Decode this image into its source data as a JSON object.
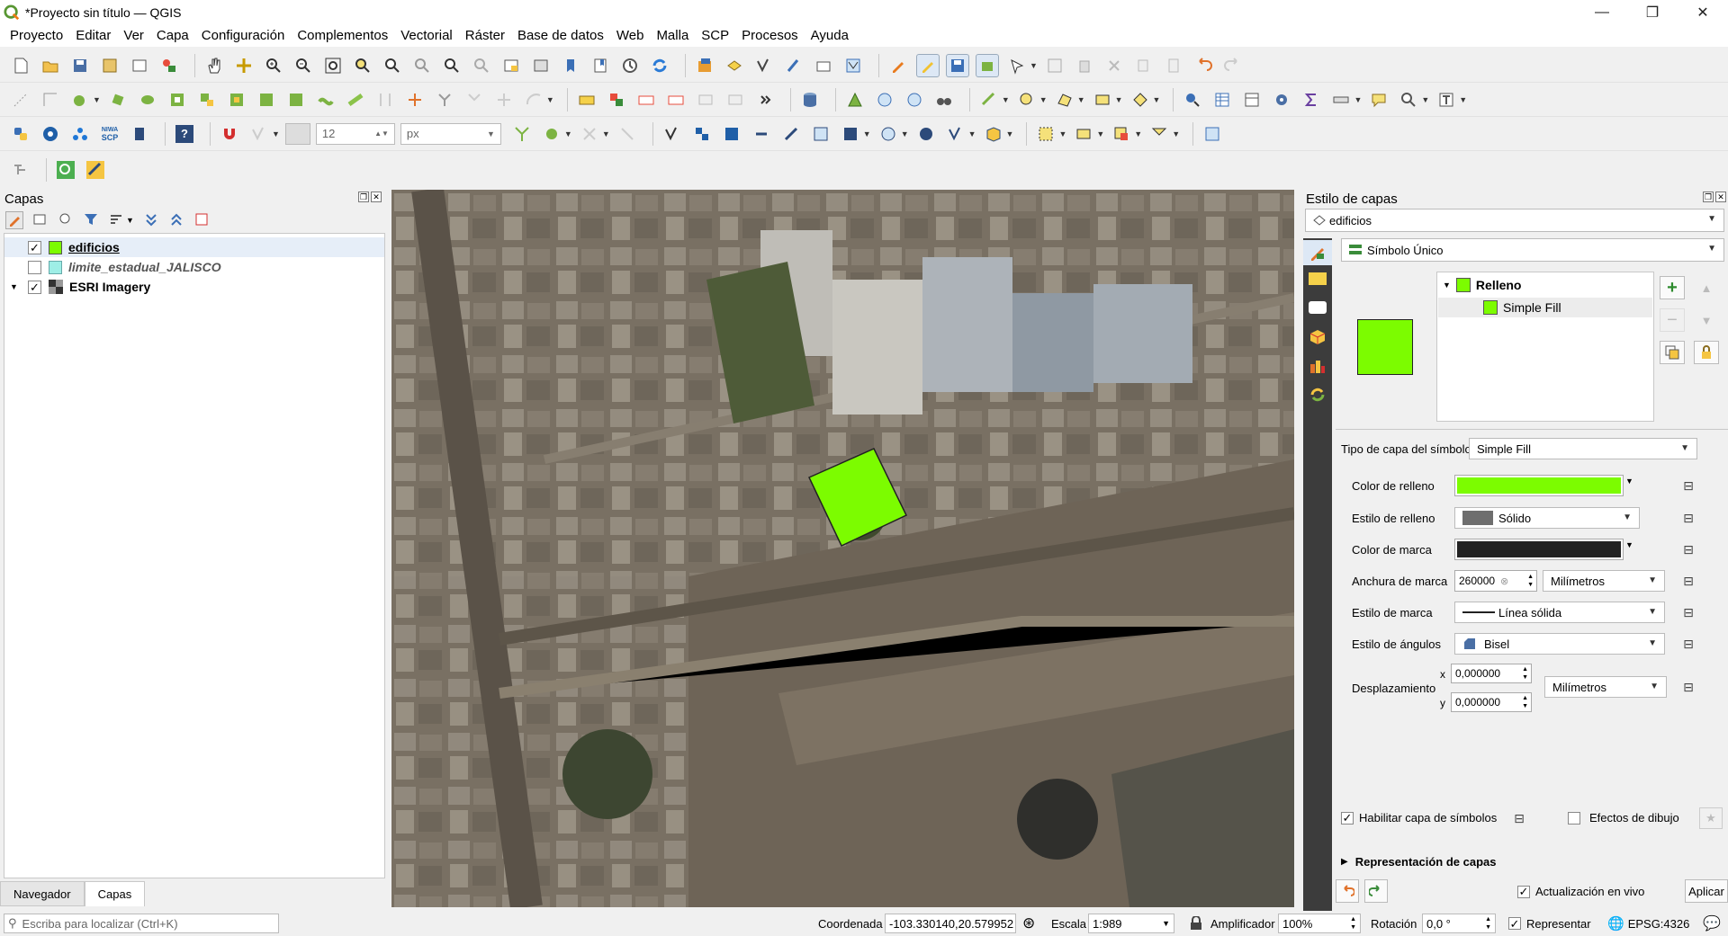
{
  "window": {
    "title": "*Proyecto sin título — QGIS",
    "minimize_glyph": "—",
    "restore_glyph": "❐",
    "close_glyph": "✕"
  },
  "menu": [
    "Proyecto",
    "Editar",
    "Ver",
    "Capa",
    "Configuración",
    "Complementos",
    "Vectorial",
    "Ráster",
    "Base de datos",
    "Web",
    "Malla",
    "SCP",
    "Procesos",
    "Ayuda"
  ],
  "toolbar3": {
    "font_size_value": "12",
    "unit_value": "px",
    "scp_label_top": "NIWA",
    "scp_label_bottom": "SCP",
    "help_glyph": "?"
  },
  "layers_panel": {
    "title": "Capas",
    "layers": [
      {
        "name": "edificios",
        "checked": true,
        "bold": true,
        "italic": false,
        "icon_color": "#7cfc00"
      },
      {
        "name": "limite_estadual_JALISCO",
        "checked": false,
        "bold": true,
        "italic": true,
        "icon_color": "#9eeee6"
      },
      {
        "name": "ESRI Imagery",
        "checked": true,
        "bold": true,
        "italic": false,
        "icon_color": "#333333"
      }
    ],
    "tabs": [
      "Navegador",
      "Capas"
    ]
  },
  "style_panel": {
    "title": "Estilo de capas",
    "layer_select": "edificios",
    "renderer": "Símbolo Único",
    "tree": {
      "root": "Relleno",
      "child": "Simple Fill"
    },
    "symbol_color": "#7cfc00",
    "symbol_layer_type_label": "Tipo de capa del símbolo",
    "symbol_layer_type": "Simple Fill",
    "fields": {
      "fill_color_label": "Color de relleno",
      "fill_color": "#7cfc00",
      "fill_style_label": "Estilo de relleno",
      "fill_style": "Sólido",
      "stroke_color_label": "Color de marca",
      "stroke_color": "#222222",
      "stroke_width_label": "Anchura de marca",
      "stroke_width": "260000",
      "stroke_width_unit": "Milímetros",
      "stroke_style_label": "Estilo de marca",
      "stroke_style": "Línea sólida",
      "join_style_label": "Estilo de ángulos",
      "join_style": "Bisel",
      "offset_label": "Desplazamiento",
      "offset_x_label": "x",
      "offset_x": "0,000000",
      "offset_y_label": "y",
      "offset_y": "0,000000",
      "offset_unit": "Milímetros"
    },
    "enable_symbol_layer": "Habilitar capa de símbolos",
    "draw_effects": "Efectos de dibujo",
    "layer_rendering": "Representación de capas",
    "live_update": "Actualización en vivo",
    "apply": "Aplicar"
  },
  "statusbar": {
    "locator_placeholder": "Escriba para localizar (Ctrl+K)",
    "coord_label": "Coordenada",
    "coord_value": "-103.330140,20.579952",
    "scale_label": "Escala",
    "scale_value": "1:989",
    "magnifier_label": "Amplificador",
    "magnifier_value": "100%",
    "rotation_label": "Rotación",
    "rotation_value": "0,0 °",
    "render_label": "Representar",
    "crs": "EPSG:4326"
  }
}
